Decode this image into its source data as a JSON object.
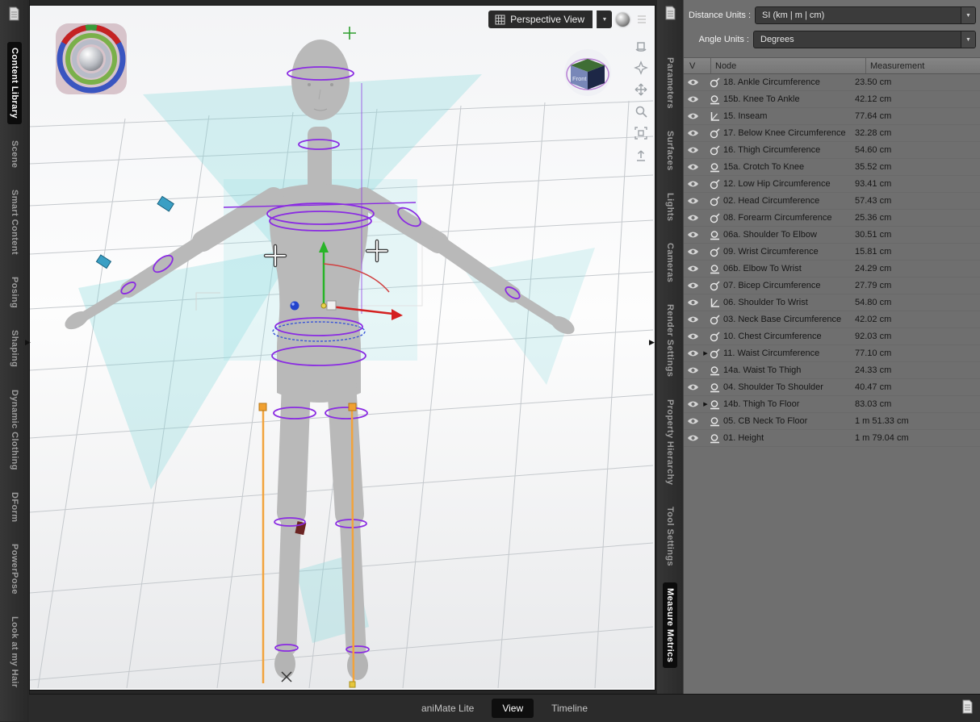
{
  "left_tabs": [
    {
      "label": "Content Library",
      "active": true
    },
    {
      "label": "Scene"
    },
    {
      "label": "Smart Content"
    },
    {
      "label": "Posing"
    },
    {
      "label": "Shaping"
    },
    {
      "label": "Dynamic Clothing"
    },
    {
      "label": "DForm"
    },
    {
      "label": "PowerPose"
    },
    {
      "label": "Look at my Hair"
    }
  ],
  "right_tabs": [
    {
      "label": "Parameters"
    },
    {
      "label": "Surfaces"
    },
    {
      "label": "Lights"
    },
    {
      "label": "Cameras"
    },
    {
      "label": "Render Settings"
    },
    {
      "label": "Property Hierarchy"
    },
    {
      "label": "Tool Settings"
    },
    {
      "label": "Measure Metrics",
      "active": true
    }
  ],
  "viewport": {
    "view_selector_label": "Perspective View",
    "view_cube_front_label": "Front",
    "tool_icons": [
      "pane-options",
      "orbit",
      "compass",
      "pan",
      "zoom",
      "frame",
      "reset"
    ]
  },
  "panel": {
    "distance_units_label": "Distance Units :",
    "distance_units_value": "SI (km | m | cm)",
    "angle_units_label": "Angle Units :",
    "angle_units_value": "Degrees",
    "table": {
      "columns": [
        "V",
        "Node",
        "Measurement"
      ],
      "rows": [
        {
          "icon": "circumference",
          "label": "18. Ankle Circumference",
          "value": "23.50 cm"
        },
        {
          "icon": "distance",
          "label": "15b. Knee To Ankle",
          "value": "42.12 cm"
        },
        {
          "icon": "caliper",
          "label": "15. Inseam",
          "value": "77.64 cm"
        },
        {
          "icon": "circumference",
          "label": "17. Below Knee Circumference",
          "value": "32.28 cm"
        },
        {
          "icon": "circumference",
          "label": "16. Thigh Circumference",
          "value": "54.60 cm"
        },
        {
          "icon": "distance",
          "label": "15a. Crotch To Knee",
          "value": "35.52 cm"
        },
        {
          "icon": "circumference",
          "label": "12. Low Hip Circumference",
          "value": "93.41 cm"
        },
        {
          "icon": "circumference",
          "label": "02. Head Circumference",
          "value": "57.43 cm"
        },
        {
          "icon": "circumference",
          "label": "08. Forearm Circumference",
          "value": "25.36 cm"
        },
        {
          "icon": "distance",
          "label": "06a. Shoulder To Elbow",
          "value": "30.51 cm"
        },
        {
          "icon": "circumference",
          "label": "09. Wrist Circumference",
          "value": "15.81 cm"
        },
        {
          "icon": "distance",
          "label": "06b. Elbow To Wrist",
          "value": "24.29 cm"
        },
        {
          "icon": "circumference",
          "label": "07. Bicep Circumference",
          "value": "27.79 cm"
        },
        {
          "icon": "caliper",
          "label": "06. Shoulder To Wrist",
          "value": "54.80 cm"
        },
        {
          "icon": "circumference",
          "label": "03. Neck Base Circumference",
          "value": "42.02 cm"
        },
        {
          "icon": "circumference",
          "label": "10. Chest Circumference",
          "value": "92.03 cm"
        },
        {
          "icon": "circumference",
          "label": "11. Waist Circumference",
          "value": "77.10 cm",
          "expandable": true
        },
        {
          "icon": "distance",
          "label": "14a. Waist To Thigh",
          "value": "24.33 cm"
        },
        {
          "icon": "distance",
          "label": "04. Shoulder To Shoulder",
          "value": "40.47 cm"
        },
        {
          "icon": "distance",
          "label": "14b. Thigh To Floor",
          "value": "83.03 cm",
          "expandable": true
        },
        {
          "icon": "distance",
          "label": "05. CB Neck To Floor",
          "value": "1 m 51.33 cm"
        },
        {
          "icon": "distance",
          "label": "01. Height",
          "value": "1 m 79.04 cm"
        }
      ]
    }
  },
  "bottom_bar": [
    {
      "label": "aniMate Lite"
    },
    {
      "label": "View",
      "active": true
    },
    {
      "label": "Timeline"
    }
  ],
  "colors": {
    "accent_purple": "#8a2be2",
    "gizmo_green": "#28b428",
    "gizmo_red": "#d42020",
    "gizmo_blue": "#2244cc",
    "watermark_teal": "#7dd6da",
    "measure_orange": "#f2a33c"
  }
}
